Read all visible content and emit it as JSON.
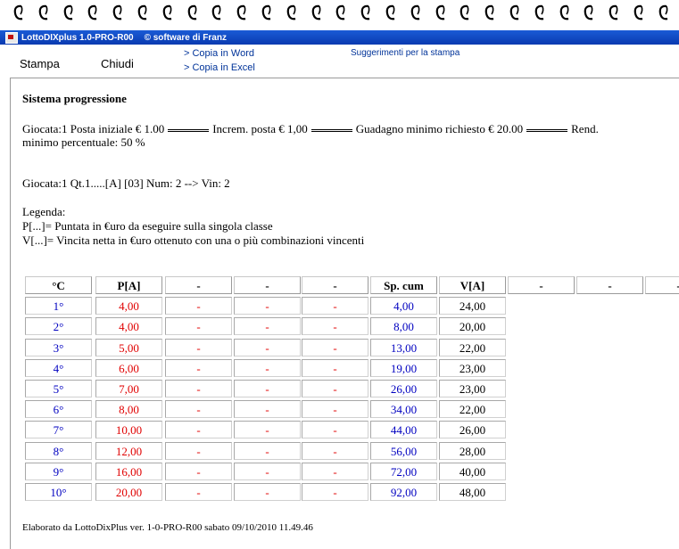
{
  "window": {
    "title": "LottoDIXplus 1.0-PRO-R00",
    "copyright": "© software di Franz"
  },
  "menu": {
    "stampa": "Stampa",
    "chiudi": "Chiudi",
    "copia_word": "> Copia in Word",
    "copia_excel": "> Copia in Excel",
    "suggerimenti": "Suggerimenti per la stampa"
  },
  "report": {
    "title": "Sistema progressione",
    "params": {
      "giocata": "Giocata:1 Posta iniziale € 1.00",
      "increm": "Increm. posta € 1,00",
      "guadagno": "Guadagno minimo richiesto € 20.00",
      "rend": "Rend.",
      "line2": "minimo percentuale: 50 %"
    },
    "giocata_line": "Giocata:1 Qt.1.....[A] [03] Num: 2 --> Vin: 2",
    "legend": {
      "title": "Legenda:",
      "p": "P[...]= Puntata in €uro da eseguire sulla singola classe",
      "v": "V[...]= Vincita netta in €uro ottenuto con una o più combinazioni vincenti"
    },
    "table": {
      "headers": [
        "°C",
        "P[A]",
        "-",
        "-",
        "-",
        "Sp. cum",
        "V[A]",
        "-",
        "-",
        "-"
      ],
      "rows": [
        [
          "1°",
          "4,00",
          "-",
          "-",
          "-",
          "4,00",
          "24,00"
        ],
        [
          "2°",
          "4,00",
          "-",
          "-",
          "-",
          "8,00",
          "20,00"
        ],
        [
          "3°",
          "5,00",
          "-",
          "-",
          "-",
          "13,00",
          "22,00"
        ],
        [
          "4°",
          "6,00",
          "-",
          "-",
          "-",
          "19,00",
          "23,00"
        ],
        [
          "5°",
          "7,00",
          "-",
          "-",
          "-",
          "26,00",
          "23,00"
        ],
        [
          "6°",
          "8,00",
          "-",
          "-",
          "-",
          "34,00",
          "22,00"
        ],
        [
          "7°",
          "10,00",
          "-",
          "-",
          "-",
          "44,00",
          "26,00"
        ],
        [
          "8°",
          "12,00",
          "-",
          "-",
          "-",
          "56,00",
          "28,00"
        ],
        [
          "9°",
          "16,00",
          "-",
          "-",
          "-",
          "72,00",
          "40,00"
        ],
        [
          "10°",
          "20,00",
          "-",
          "-",
          "-",
          "92,00",
          "48,00"
        ]
      ]
    },
    "footer": "Elaborato da LottoDixPlus ver. 1-0-PRO-R00 sabato 09/10/2010 11.49.46"
  },
  "colors": {
    "titlebar": "#0a3ab0",
    "link": "#003399",
    "blue_text": "#0000c0",
    "red_text": "#e00000"
  }
}
